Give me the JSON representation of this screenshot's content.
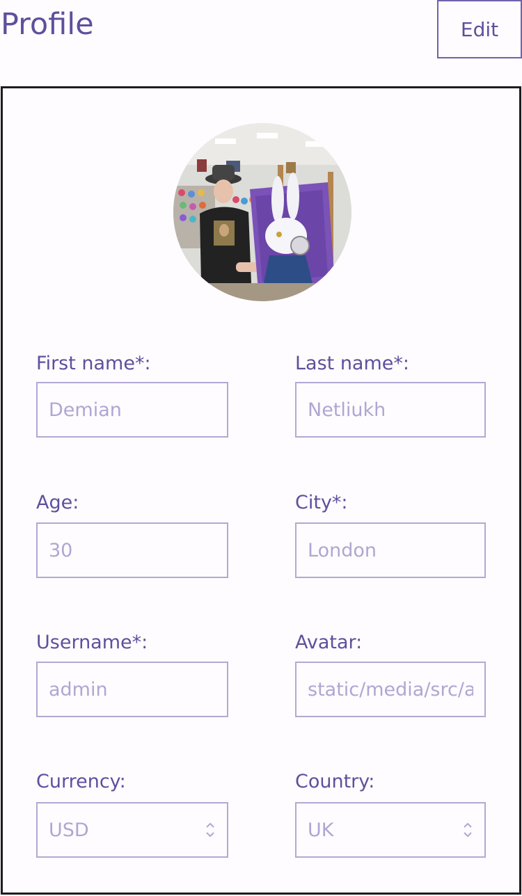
{
  "header": {
    "title": "Profile",
    "edit_label": "Edit"
  },
  "profile": {
    "avatar_alt": "avatar",
    "fields": {
      "first_name": {
        "label": "First name*:",
        "placeholder": "Demian"
      },
      "last_name": {
        "label": "Last name*:",
        "placeholder": "Netliukh"
      },
      "age": {
        "label": "Age:",
        "placeholder": "30"
      },
      "city": {
        "label": "City*:",
        "placeholder": "London"
      },
      "username": {
        "label": "Username*:",
        "placeholder": "admin"
      },
      "avatar": {
        "label": "Avatar:",
        "placeholder": "static/media/src/avatar.jpg"
      },
      "currency": {
        "label": "Currency:",
        "value": "USD"
      },
      "country": {
        "label": "Country:",
        "value": "UK"
      }
    }
  },
  "colors": {
    "accent": "#5f4f9d",
    "input_border": "#b3a8d3",
    "placeholder": "#b0a6d2",
    "card_border": "#1d1d1d"
  },
  "icons": {
    "select_chevron": "chevron-up-down-icon"
  }
}
